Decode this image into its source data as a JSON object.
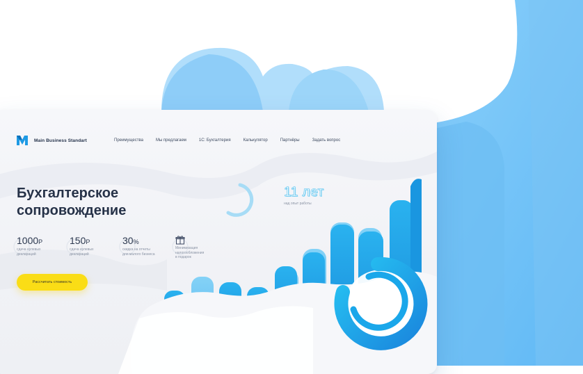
{
  "brand": {
    "name": "Main Business Standart",
    "accent": "#1e9ae4",
    "cta_color": "#fadd16",
    "text_color": "#263248"
  },
  "nav": {
    "items": [
      {
        "label": "Преимущества"
      },
      {
        "label": "Мы предлагаем"
      },
      {
        "label": "1С: Бухгалтерия"
      },
      {
        "label": "Калькулятор"
      },
      {
        "label": "Партнёры"
      },
      {
        "label": "Задать вопрос"
      }
    ]
  },
  "hero": {
    "title_line1": "Бухгалтерское",
    "title_line2": "сопровождение",
    "stats": [
      {
        "value": "1000",
        "unit": "Р",
        "desc_line1": "сдача нулевых",
        "desc_line2": "деклараций"
      },
      {
        "value": "150",
        "unit": "Р",
        "desc_line1": "сдача нулевых",
        "desc_line2": "деклараций"
      },
      {
        "value": "30",
        "unit": "%",
        "desc_line1": "скидка на отчеты",
        "desc_line2": "для малого бизнеса"
      },
      {
        "icon": "gift-icon",
        "desc_line1": "Минимизация",
        "desc_line2": "налогообложения",
        "desc_line3": "в подарок"
      }
    ],
    "cta_label": "Рассчитать стоимость",
    "experience": {
      "value": "11 лет",
      "desc": "над опыт работы"
    }
  }
}
